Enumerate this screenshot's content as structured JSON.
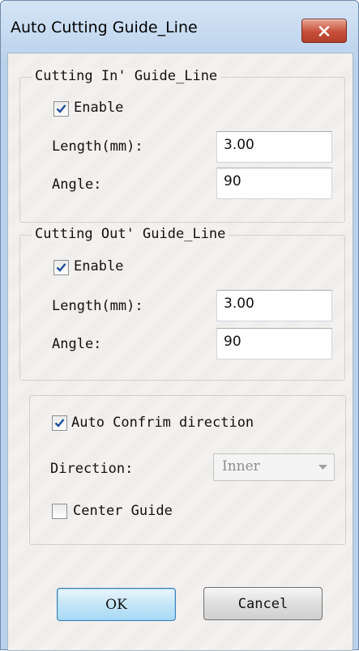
{
  "window": {
    "title": "Auto Cutting Guide_Line"
  },
  "cut_in": {
    "group_title": "Cutting In' Guide_Line",
    "enable_label": "Enable",
    "enable_checked": true,
    "length_label": "Length(mm):",
    "length_value": "3.00",
    "angle_label": "Angle:",
    "angle_value": "90"
  },
  "cut_out": {
    "group_title": "Cutting Out' Guide_Line",
    "enable_label": "Enable",
    "enable_checked": true,
    "length_label": "Length(mm):",
    "length_value": "3.00",
    "angle_label": "Angle:",
    "angle_value": "90"
  },
  "direction": {
    "auto_confirm_label": "Auto Confrim direction",
    "auto_confirm_checked": true,
    "direction_label": "Direction:",
    "direction_value": "Inner",
    "center_guide_label": "Center Guide",
    "center_guide_checked": false
  },
  "buttons": {
    "ok_label": "OK",
    "cancel_label": "Cancel"
  },
  "icons": {
    "close": "close-icon",
    "check": "checkmark-icon",
    "dropdown": "chevron-down-icon"
  },
  "colors": {
    "title_bar": "#bcd3ec",
    "close_button": "#c7503a",
    "default_button": "#c4e5f6"
  }
}
